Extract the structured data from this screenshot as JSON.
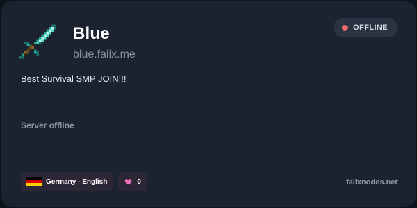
{
  "server": {
    "name": "Blue",
    "address": "blue.falix.me",
    "description": "Best Survival SMP JOIN!!!",
    "icon": "diamond-sword-icon"
  },
  "status": {
    "label": "OFFLINE",
    "color": "#ef6b6b",
    "message": "Server offline"
  },
  "footer": {
    "locale": "Germany · English",
    "flag_icon": "germany-flag-icon",
    "flag_colors": [
      "#000000",
      "#dd0000",
      "#ffce00"
    ],
    "likes": "0",
    "likes_icon": "heart-icon",
    "likes_color": "#f06fb8",
    "site": "falixnodes.net"
  },
  "colors": {
    "background": "#0e141c",
    "card": "#1b2230",
    "chip": "#2d2634",
    "badge": "#2b3342"
  }
}
